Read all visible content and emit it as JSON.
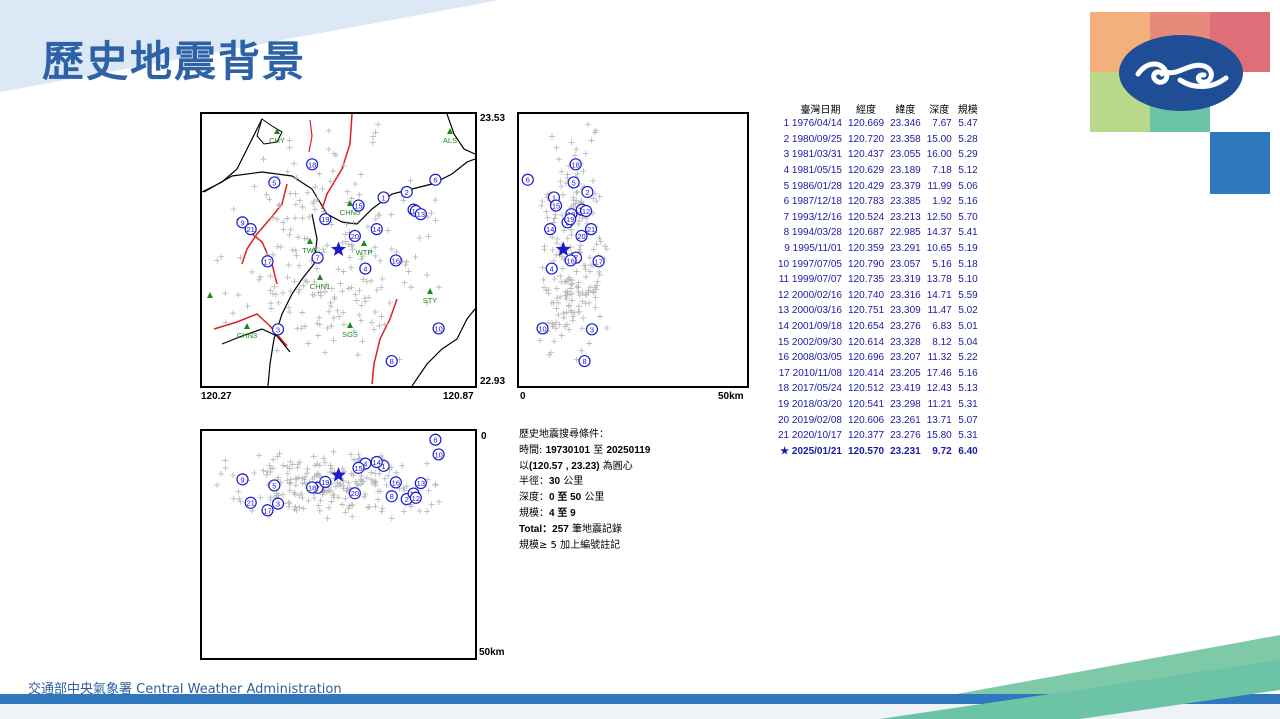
{
  "page": {
    "title": "歷史地震背景",
    "footer": "交通部中央氣象署 Central Weather Administration",
    "logo_colors": [
      "#f4b07c",
      "#e88a7b",
      "#de6f78",
      "#b8d98a",
      "#6cc3a5",
      "#2f78bd"
    ]
  },
  "map": {
    "lat_top": "23.53",
    "lat_bottom": "22.93",
    "lon_left": "120.27",
    "lon_right": "120.87",
    "stations": [
      "CHY",
      "ALS",
      "CHN5",
      "TWL",
      "WTP",
      "CHN1",
      "STY",
      "SGS",
      "CHN3"
    ],
    "epicenter_symbol": "star"
  },
  "ns_section": {
    "top_label": "",
    "bottom_label": "0",
    "right_label": "50km"
  },
  "ew_section": {
    "top_label": "0",
    "bottom_label": "50km"
  },
  "criteria": {
    "heading": "歷史地震搜尋條件：",
    "time_label": "時間:",
    "time_from": "19730101",
    "time_to_word": "至",
    "time_to": "20250119",
    "center_prefix": "以",
    "center_value": "(120.57 , 23.23)",
    "center_suffix": "為圓心",
    "radius_label": "半徑：",
    "radius_value": "30",
    "radius_unit": "公里",
    "depth_label": "深度：",
    "depth_value": "0 至 50",
    "depth_unit": "公里",
    "mag_label": "規模：",
    "mag_value": "4 至 9",
    "total_label": "Total：",
    "total_value": "257",
    "total_unit": "筆地震記錄",
    "note": "規模≥ 5 加上編號註記"
  },
  "table": {
    "headers": [
      "臺灣日期",
      "經度",
      "緯度",
      "深度",
      "規模"
    ],
    "rows": [
      [
        "1",
        "1976/04/14",
        "120.669",
        "23.346",
        "7.67",
        "5.47"
      ],
      [
        "2",
        "1980/09/25",
        "120.720",
        "23.358",
        "15.00",
        "5.28"
      ],
      [
        "3",
        "1981/03/31",
        "120.437",
        "23.055",
        "16.00",
        "5.29"
      ],
      [
        "4",
        "1981/05/15",
        "120.629",
        "23.189",
        "7.18",
        "5.12"
      ],
      [
        "5",
        "1986/01/28",
        "120.429",
        "23.379",
        "11.99",
        "5.06"
      ],
      [
        "6",
        "1987/12/18",
        "120.783",
        "23.385",
        "1.92",
        "5.16"
      ],
      [
        "7",
        "1993/12/16",
        "120.524",
        "23.213",
        "12.50",
        "5.70"
      ],
      [
        "8",
        "1994/03/28",
        "120.687",
        "22.985",
        "14.37",
        "5.41"
      ],
      [
        "9",
        "1995/11/01",
        "120.359",
        "23.291",
        "10.65",
        "5.19"
      ],
      [
        "10",
        "1997/07/05",
        "120.790",
        "23.057",
        "5.16",
        "5.18"
      ],
      [
        "11",
        "1999/07/07",
        "120.735",
        "23.319",
        "13.78",
        "5.10"
      ],
      [
        "12",
        "2000/02/16",
        "120.740",
        "23.316",
        "14.71",
        "5.59"
      ],
      [
        "13",
        "2000/03/16",
        "120.751",
        "23.309",
        "11.47",
        "5.02"
      ],
      [
        "14",
        "2001/09/18",
        "120.654",
        "23.276",
        "6.83",
        "5.01"
      ],
      [
        "15",
        "2002/09/30",
        "120.614",
        "23.328",
        "8.12",
        "5.04"
      ],
      [
        "16",
        "2008/03/05",
        "120.696",
        "23.207",
        "11.32",
        "5.22"
      ],
      [
        "17",
        "2010/11/08",
        "120.414",
        "23.205",
        "17.46",
        "5.16"
      ],
      [
        "18",
        "2017/05/24",
        "120.512",
        "23.419",
        "12.43",
        "5.13"
      ],
      [
        "19",
        "2018/03/20",
        "120.541",
        "23.298",
        "11.21",
        "5.31"
      ],
      [
        "20",
        "2019/02/08",
        "120.606",
        "23.261",
        "13.71",
        "5.07"
      ],
      [
        "21",
        "2020/10/17",
        "120.377",
        "23.276",
        "15.80",
        "5.31"
      ]
    ],
    "main_event": [
      "★",
      "2025/01/21",
      "120.570",
      "23.231",
      "9.72",
      "6.40"
    ]
  }
}
